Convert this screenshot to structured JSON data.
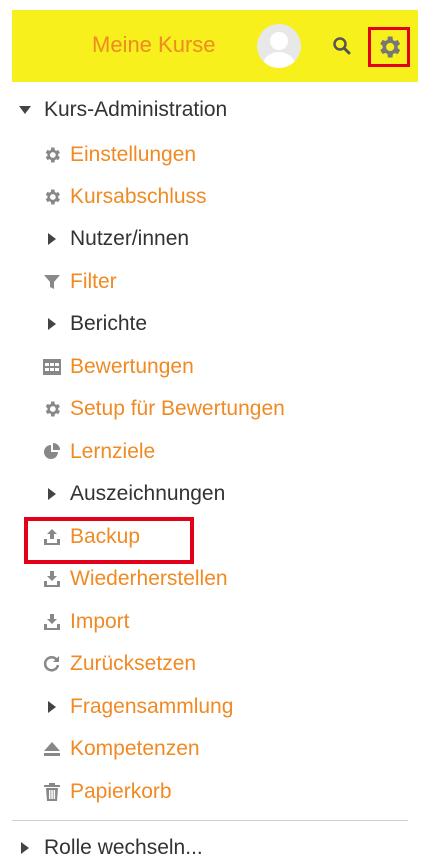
{
  "header": {
    "my_courses": "Meine Kurse",
    "avatar": "avatar",
    "search_icon": "search-icon",
    "settings_icon": "gear-icon"
  },
  "menu": {
    "title": "Kurs-Administration",
    "items": [
      {
        "label": "Einstellungen",
        "icon": "gear-icon",
        "color": "#f08a24"
      },
      {
        "label": "Kursabschluss",
        "icon": "gear-icon",
        "color": "#f08a24"
      },
      {
        "label": "Nutzer/innen",
        "icon": "caret-right-icon",
        "color": "#333333"
      },
      {
        "label": "Filter",
        "icon": "filter-icon",
        "color": "#f08a24"
      },
      {
        "label": "Berichte",
        "icon": "caret-right-icon",
        "color": "#333333"
      },
      {
        "label": "Bewertungen",
        "icon": "table-icon",
        "color": "#f08a24"
      },
      {
        "label": "Setup für Bewertungen",
        "icon": "gear-icon",
        "color": "#f08a24"
      },
      {
        "label": "Lernziele",
        "icon": "pie-icon",
        "color": "#f08a24"
      },
      {
        "label": "Auszeichnungen",
        "icon": "caret-right-icon",
        "color": "#333333"
      },
      {
        "label": "Backup",
        "icon": "upload-icon",
        "color": "#f08a24"
      },
      {
        "label": "Wiederherstellen",
        "icon": "download-icon",
        "color": "#f08a24"
      },
      {
        "label": "Import",
        "icon": "download-icon",
        "color": "#f08a24"
      },
      {
        "label": "Zurücksetzen",
        "icon": "refresh-icon",
        "color": "#f08a24"
      },
      {
        "label": "Fragensammlung",
        "icon": "caret-right-icon",
        "color": "#333333"
      },
      {
        "label": "Kompetenzen",
        "icon": "eject-icon",
        "color": "#f08a24"
      },
      {
        "label": "Papierkorb",
        "icon": "trash-icon",
        "color": "#f08a24"
      }
    ],
    "switch_role": "Rolle wechseln..."
  }
}
